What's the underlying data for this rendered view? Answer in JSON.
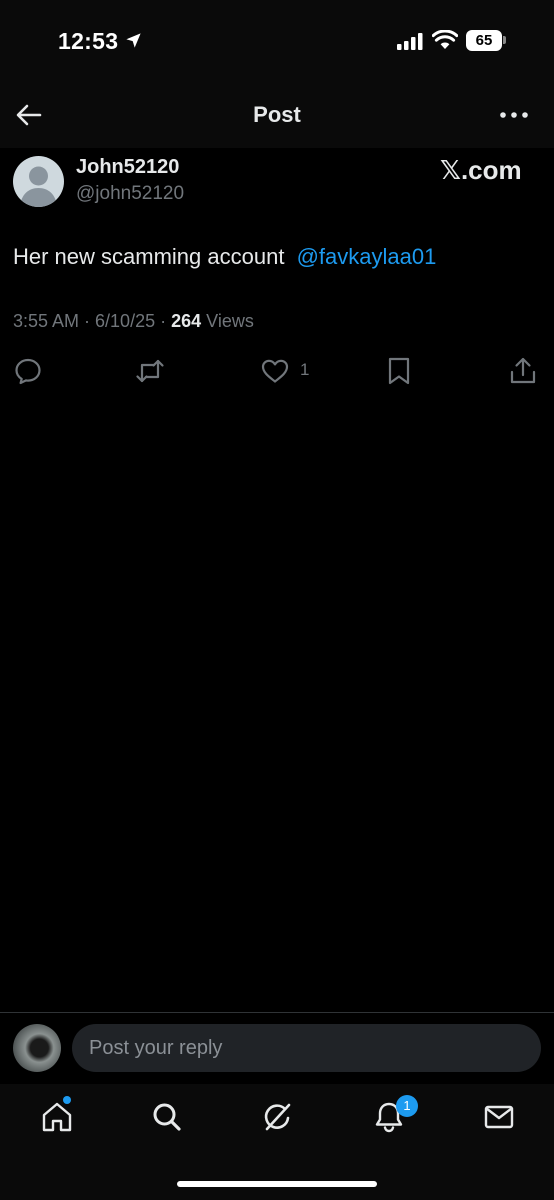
{
  "status_bar": {
    "time": "12:53",
    "battery": "65",
    "icons": [
      "location-arrow-icon",
      "signal-icon",
      "wifi-icon",
      "battery-icon"
    ]
  },
  "header": {
    "title": "Post",
    "back_icon": "arrow-left-icon",
    "more_icon": "more-horizontal-icon"
  },
  "post": {
    "author_name": "John52120",
    "author_handle": "@john52120",
    "watermark": "𝕏.com",
    "text": "Her new scamming account",
    "mention": "@favkaylaa01",
    "timestamp": "3:55 AM · 6/10/25 · ",
    "views_count": "264",
    "views_label": " Views",
    "actions": {
      "reply_icon": "reply-icon",
      "repost_icon": "repost-icon",
      "like_icon": "heart-icon",
      "like_count": "1",
      "bookmark_icon": "bookmark-icon",
      "share_icon": "share-icon"
    }
  },
  "reply": {
    "placeholder": "Post your reply"
  },
  "tabs": {
    "items": [
      "home-icon",
      "search-icon",
      "grok-icon",
      "notifications-icon",
      "messages-icon"
    ],
    "notification_badge": "1"
  },
  "colors": {
    "background": "#000000",
    "accent": "#1d9bf0",
    "text": "#e7e9ea",
    "muted": "#71767b"
  }
}
